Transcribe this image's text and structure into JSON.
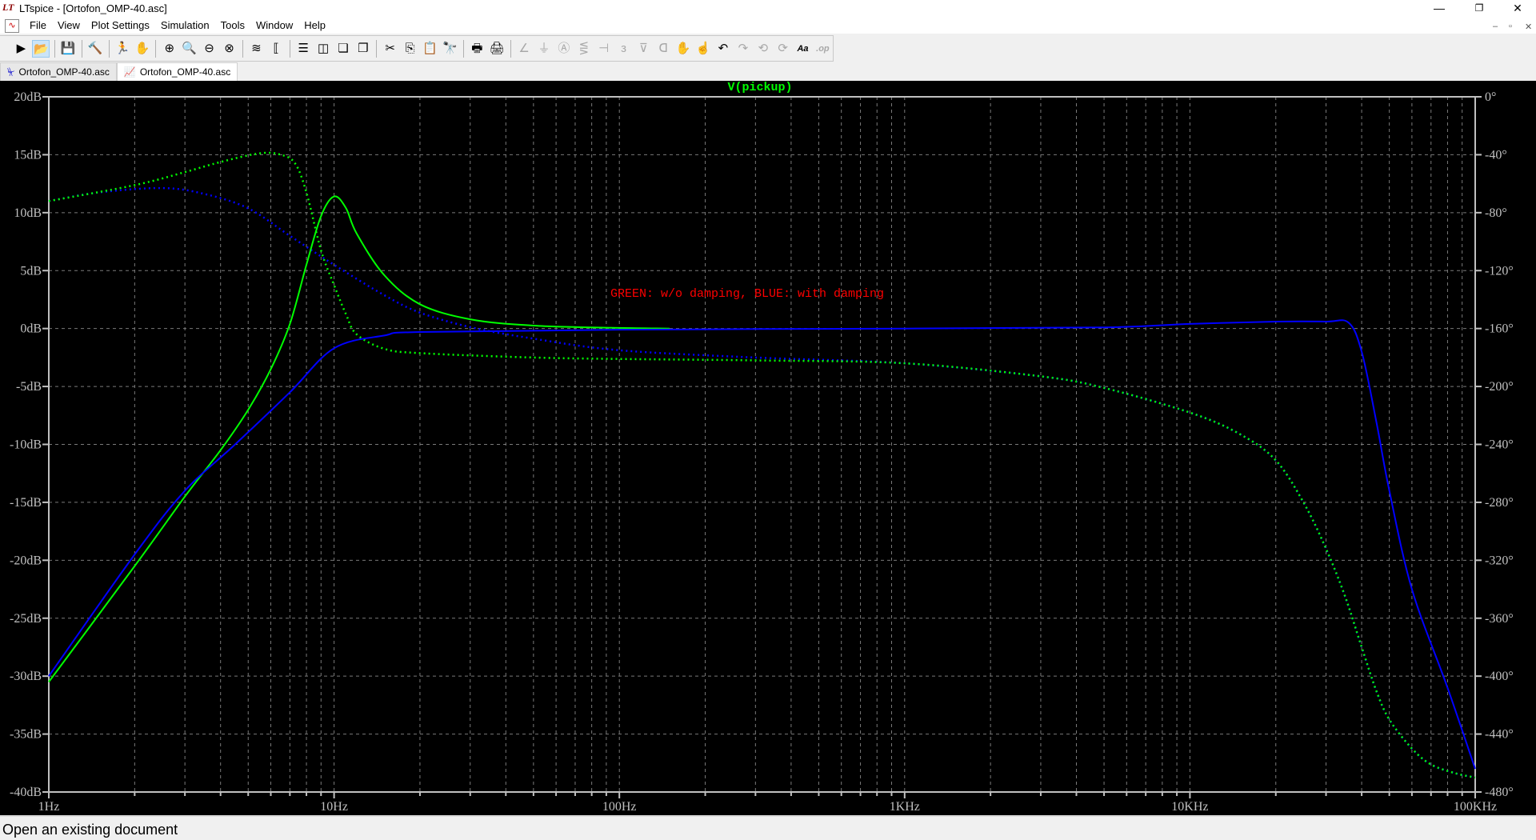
{
  "window": {
    "title": "LTspice - [Ortofon_OMP-40.asc]",
    "logo": "LT",
    "controls": [
      "—",
      "❐",
      "✕"
    ],
    "mdi_controls": [
      "–",
      "▫",
      "✕"
    ]
  },
  "menu": [
    "File",
    "View",
    "Plot Settings",
    "Simulation",
    "Tools",
    "Window",
    "Help"
  ],
  "toolbar": [
    [
      {
        "name": "run-icon",
        "g": "▶"
      },
      {
        "name": "open-icon",
        "g": "📂",
        "active": true
      }
    ],
    [
      {
        "name": "save-icon",
        "g": "💾"
      }
    ],
    [
      {
        "name": "control-panel-icon",
        "g": "🔨"
      }
    ],
    [
      {
        "name": "run-simulation-icon",
        "g": "🏃"
      },
      {
        "name": "halt-icon",
        "g": "✋",
        "dis": true
      }
    ],
    [
      {
        "name": "zoom-in-icon",
        "g": "⊕"
      },
      {
        "name": "zoom-area-icon",
        "g": "🔍"
      },
      {
        "name": "zoom-out-icon",
        "g": "⊖"
      },
      {
        "name": "zoom-cancel-icon",
        "g": "⊗"
      }
    ],
    [
      {
        "name": "autorange-icon",
        "g": "≋"
      },
      {
        "name": "add-trace-icon",
        "g": "⟦"
      }
    ],
    [
      {
        "name": "tile-horizontal-icon",
        "g": "☰"
      },
      {
        "name": "tile-vertical-icon",
        "g": "◫"
      },
      {
        "name": "cascade-icon",
        "g": "❏"
      },
      {
        "name": "arrange-icon",
        "g": "❐"
      }
    ],
    [
      {
        "name": "cut-icon",
        "g": "✂"
      },
      {
        "name": "copy-icon",
        "g": "⎘"
      },
      {
        "name": "paste-icon",
        "g": "📋",
        "dis": true
      },
      {
        "name": "find-icon",
        "g": "🔭"
      }
    ],
    [
      {
        "name": "page-setup-icon",
        "g": "🖶"
      },
      {
        "name": "print-icon",
        "g": "🖨"
      }
    ],
    [
      {
        "name": "wire-icon",
        "g": "∠",
        "dis": true
      },
      {
        "name": "ground-icon",
        "g": "⏚",
        "dis": true
      },
      {
        "name": "label-icon",
        "g": "Ⓐ",
        "dis": true
      },
      {
        "name": "resistor-icon",
        "g": "⋚",
        "dis": true
      },
      {
        "name": "capacitor-icon",
        "g": "⊣",
        "dis": true
      },
      {
        "name": "inductor-icon",
        "g": "з",
        "dis": true
      },
      {
        "name": "diode-icon",
        "g": "⊽",
        "dis": true
      },
      {
        "name": "component-icon",
        "g": "ᗡ",
        "dis": true
      },
      {
        "name": "move-icon",
        "g": "✋"
      },
      {
        "name": "drag-icon",
        "g": "☝"
      },
      {
        "name": "undo-icon",
        "g": "↶"
      },
      {
        "name": "redo-icon",
        "g": "↷",
        "dis": true
      },
      {
        "name": "rotate-icon",
        "g": "⟲",
        "dis": true
      },
      {
        "name": "mirror-icon",
        "g": "⟳",
        "dis": true
      },
      {
        "name": "text-icon",
        "g": "Aa"
      },
      {
        "name": "spice-directive-icon",
        "g": ".op",
        "dis": true
      }
    ]
  ],
  "tabs": [
    {
      "label": "Ortofon_OMP-40.asc",
      "icon": "schematic-icon",
      "g": "⏧"
    },
    {
      "label": "Ortofon_OMP-40.asc",
      "icon": "waveform-icon",
      "g": "📈",
      "active": true
    }
  ],
  "status": "Open an existing document",
  "chart_data": {
    "type": "line",
    "title": "V(pickup)",
    "annotation": "GREEN: w/o damping, BLUE: with damping",
    "xscale": "log",
    "xlim": [
      1,
      100000
    ],
    "ylim": [
      -40,
      20
    ],
    "y2lim": [
      -480,
      0
    ],
    "xticks": [
      {
        "v": 1,
        "label": "1Hz"
      },
      {
        "v": 10,
        "label": "10Hz"
      },
      {
        "v": 100,
        "label": "100Hz"
      },
      {
        "v": 1000,
        "label": "1KHz"
      },
      {
        "v": 10000,
        "label": "10KHz"
      },
      {
        "v": 100000,
        "label": "100KHz"
      }
    ],
    "yticks": [
      {
        "v": 20,
        "label": "20dB"
      },
      {
        "v": 15,
        "label": "15dB"
      },
      {
        "v": 10,
        "label": "10dB"
      },
      {
        "v": 5,
        "label": "5dB"
      },
      {
        "v": 0,
        "label": "0dB"
      },
      {
        "v": -5,
        "label": "-5dB"
      },
      {
        "v": -10,
        "label": "-10dB"
      },
      {
        "v": -15,
        "label": "-15dB"
      },
      {
        "v": -20,
        "label": "-20dB"
      },
      {
        "v": -25,
        "label": "-25dB"
      },
      {
        "v": -30,
        "label": "-30dB"
      },
      {
        "v": -35,
        "label": "-35dB"
      },
      {
        "v": -40,
        "label": "-40dB"
      }
    ],
    "y2ticks": [
      {
        "v": 0,
        "label": "0°"
      },
      {
        "v": -40,
        "label": "-40°"
      },
      {
        "v": -80,
        "label": "-80°"
      },
      {
        "v": -120,
        "label": "-120°"
      },
      {
        "v": -160,
        "label": "-160°"
      },
      {
        "v": -200,
        "label": "-200°"
      },
      {
        "v": -240,
        "label": "-240°"
      },
      {
        "v": -280,
        "label": "-280°"
      },
      {
        "v": -320,
        "label": "-320°"
      },
      {
        "v": -360,
        "label": "-360°"
      },
      {
        "v": -400,
        "label": "-400°"
      },
      {
        "v": -440,
        "label": "-440°"
      },
      {
        "v": -480,
        "label": "-480°"
      }
    ],
    "grid": true,
    "colors": {
      "green": "#00ff00",
      "blue": "#0000ff",
      "annotation": "#ff0000",
      "axis": "#c0c0c0",
      "background": "#000000"
    },
    "series": [
      {
        "name": "blue-phase",
        "color": "#0000ff",
        "axis": "right",
        "style": "dotted",
        "points": [
          [
            1,
            -72
          ],
          [
            1.5,
            -66
          ],
          [
            2.5,
            -63
          ],
          [
            3.5,
            -67
          ],
          [
            5,
            -77
          ],
          [
            7,
            -96
          ],
          [
            10,
            -116
          ],
          [
            15,
            -137
          ],
          [
            20,
            -149
          ],
          [
            30,
            -159
          ],
          [
            50,
            -167
          ],
          [
            100,
            -175
          ],
          [
            300,
            -180
          ],
          [
            1000,
            -184
          ],
          [
            3000,
            -193
          ],
          [
            5000,
            -201
          ],
          [
            10000,
            -218
          ],
          [
            15000,
            -233
          ],
          [
            20000,
            -251
          ],
          [
            25000,
            -280
          ],
          [
            30000,
            -312
          ],
          [
            35000,
            -345
          ],
          [
            40000,
            -380
          ],
          [
            45000,
            -410
          ],
          [
            50000,
            -430
          ],
          [
            60000,
            -450
          ],
          [
            70000,
            -461
          ],
          [
            85000,
            -467
          ],
          [
            100000,
            -470
          ]
        ]
      },
      {
        "name": "green-phase",
        "color": "#00ff00",
        "axis": "right",
        "style": "dotted",
        "points": [
          [
            1,
            -72
          ],
          [
            2,
            -61
          ],
          [
            3,
            -52
          ],
          [
            4,
            -45
          ],
          [
            5.5,
            -39
          ],
          [
            6.5,
            -40
          ],
          [
            7.3,
            -46
          ],
          [
            8,
            -66
          ],
          [
            9,
            -106
          ],
          [
            10,
            -130
          ],
          [
            11,
            -150
          ],
          [
            12,
            -164
          ],
          [
            15,
            -174
          ],
          [
            20,
            -177
          ],
          [
            50,
            -180
          ],
          [
            100,
            -181
          ],
          [
            300,
            -182
          ],
          [
            1000,
            -184
          ],
          [
            3000,
            -193
          ],
          [
            5000,
            -201
          ],
          [
            10000,
            -218
          ],
          [
            15000,
            -233
          ],
          [
            20000,
            -251
          ],
          [
            25000,
            -280
          ],
          [
            30000,
            -312
          ],
          [
            35000,
            -345
          ],
          [
            40000,
            -380
          ],
          [
            45000,
            -410
          ],
          [
            50000,
            -430
          ],
          [
            60000,
            -450
          ],
          [
            70000,
            -461
          ],
          [
            85000,
            -467
          ],
          [
            100000,
            -470
          ]
        ]
      },
      {
        "name": "green-magnitude",
        "color": "#00ff00",
        "axis": "left",
        "style": "solid",
        "points": [
          [
            1,
            -30.5
          ],
          [
            2,
            -20.5
          ],
          [
            3,
            -14.5
          ],
          [
            4,
            -10.5
          ],
          [
            5,
            -7
          ],
          [
            6,
            -3.5
          ],
          [
            7,
            0.4
          ],
          [
            8,
            5.5
          ],
          [
            9,
            9.7
          ],
          [
            10,
            11.4
          ],
          [
            11,
            10.4
          ],
          [
            12,
            8.2
          ],
          [
            15,
            4.6
          ],
          [
            20,
            2.1
          ],
          [
            30,
            0.8
          ],
          [
            50,
            0.25
          ],
          [
            100,
            0.05
          ],
          [
            150,
            0
          ]
        ]
      },
      {
        "name": "blue-magnitude",
        "color": "#0000ff",
        "axis": "left",
        "style": "solid",
        "points": [
          [
            1,
            -30
          ],
          [
            2,
            -19.5
          ],
          [
            3,
            -14
          ],
          [
            4.5,
            -10
          ],
          [
            7,
            -5.5
          ],
          [
            10,
            -1.7
          ],
          [
            15,
            -0.6
          ],
          [
            20,
            -0.3
          ],
          [
            100,
            -0.1
          ],
          [
            1000,
            0
          ],
          [
            5000,
            0.1
          ],
          [
            10000,
            0.4
          ],
          [
            20000,
            0.6
          ],
          [
            30000,
            0.6
          ],
          [
            36000,
            0.5
          ],
          [
            40000,
            -2
          ],
          [
            45000,
            -8
          ],
          [
            50000,
            -14
          ],
          [
            60000,
            -22.5
          ],
          [
            80000,
            -31
          ],
          [
            100000,
            -38
          ]
        ]
      }
    ]
  }
}
